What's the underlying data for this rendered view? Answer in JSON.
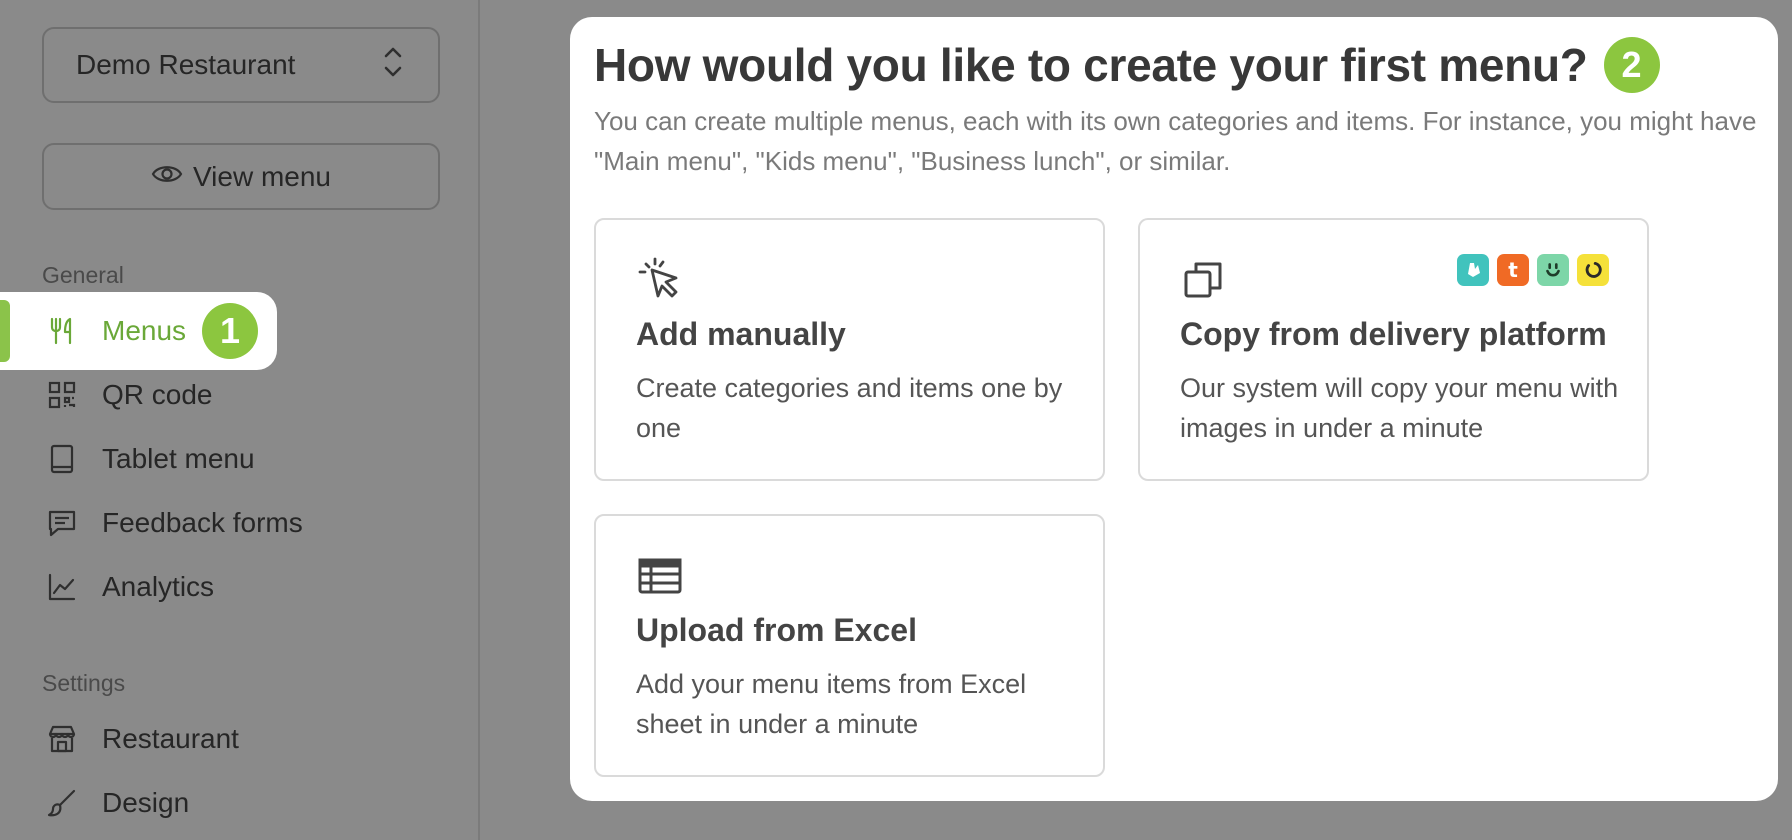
{
  "sidebar": {
    "restaurant_select": {
      "value": "Demo Restaurant"
    },
    "view_menu_label": "View menu",
    "sections": [
      {
        "label": "General",
        "items": [
          {
            "label": "Menus",
            "icon": "fork-knife-icon",
            "active": true,
            "badge": "1"
          },
          {
            "label": "QR code",
            "icon": "qr-code-icon"
          },
          {
            "label": "Tablet menu",
            "icon": "tablet-icon"
          },
          {
            "label": "Feedback forms",
            "icon": "chat-bubble-icon"
          },
          {
            "label": "Analytics",
            "icon": "line-chart-icon"
          }
        ]
      },
      {
        "label": "Settings",
        "items": [
          {
            "label": "Restaurant",
            "icon": "storefront-icon"
          },
          {
            "label": "Design",
            "icon": "paintbrush-icon"
          }
        ]
      }
    ]
  },
  "panel": {
    "title": "How would you like to create your first menu?",
    "badge": "2",
    "description": "You can create multiple menus, each with its own categories and items. For instance, you might have \"Main menu\", \"Kids menu\", \"Business lunch\", or similar.",
    "options": [
      {
        "icon": "cursor-click-icon",
        "title": "Add manually",
        "description": "Create categories and items one by one"
      },
      {
        "icon": "copy-icon",
        "title": "Copy from delivery platform",
        "description": "Our system will copy your menu with images in under a minute",
        "platform_logos": [
          {
            "name": "deliveroo-logo",
            "color": "#41c3bd"
          },
          {
            "name": "talabat-logo",
            "color": "#f06a25"
          },
          {
            "name": "smile-logo",
            "color": "#7dd6a8"
          },
          {
            "name": "yellow-ring-logo",
            "color": "#f5e13a"
          }
        ]
      },
      {
        "icon": "table-icon",
        "title": "Upload from Excel",
        "description": "Add your menu items from Excel sheet in under a minute"
      }
    ]
  },
  "colors": {
    "accent": "#8cc63f",
    "active_text": "#6aa838",
    "overlay": "#8a8a8a"
  }
}
